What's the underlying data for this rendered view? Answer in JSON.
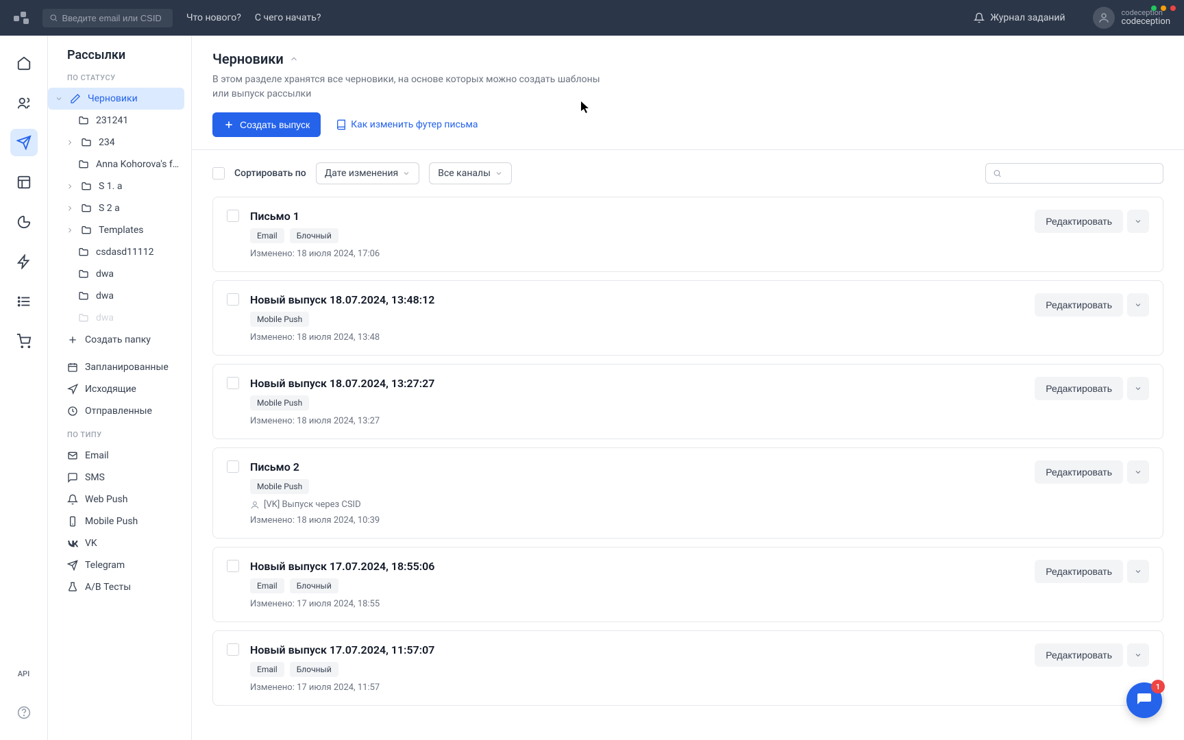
{
  "topbar": {
    "search_placeholder": "Введите email или CSID",
    "links": [
      "Что нового?",
      "С чего начать?"
    ],
    "journal": "Журнал заданий",
    "user_org": "codeception",
    "user_name": "codeception"
  },
  "sidebar": {
    "title": "Рассылки",
    "group_status": "ПО СТАТУСУ",
    "group_type": "ПО ТИПУ",
    "drafts": "Черновики",
    "folders": [
      {
        "label": "231241",
        "has_children": false
      },
      {
        "label": "234",
        "has_children": true
      },
      {
        "label": "Anna Kohorova's f…",
        "has_children": false
      },
      {
        "label": "S 1. a",
        "has_children": true
      },
      {
        "label": "S 2 a",
        "has_children": true
      },
      {
        "label": "Templates",
        "has_children": true
      },
      {
        "label": "csdasd11112",
        "has_children": false
      },
      {
        "label": "dwa",
        "has_children": false
      },
      {
        "label": "dwa",
        "has_children": false
      },
      {
        "label": "dwa",
        "has_children": false,
        "disabled": true
      }
    ],
    "create_folder": "Создать папку",
    "scheduled": "Запланированные",
    "outbox": "Исходящие",
    "sent": "Отправленные",
    "types": [
      "Email",
      "SMS",
      "Web Push",
      "Mobile Push",
      "VK",
      "Telegram",
      "A/B Тесты"
    ]
  },
  "rail": {
    "api": "API"
  },
  "main": {
    "title": "Черновики",
    "desc": "В этом разделе хранятся все черновики, на основе которых можно создать шаблоны или выпуск рассылки",
    "create_btn": "Создать выпуск",
    "footer_link": "Как изменить футер письма",
    "sort_label": "Сортировать по",
    "sort_value": "Дате изменения",
    "channel_value": "Все каналы"
  },
  "drafts": [
    {
      "title": "Письмо 1",
      "tags": [
        "Email",
        "Блочный"
      ],
      "meta_prefix": "Изменено:",
      "meta_date": "18 июля 2024, 17:06",
      "vk_line": null
    },
    {
      "title": "Новый выпуск 18.07.2024, 13:48:12",
      "tags": [
        "Mobile Push"
      ],
      "meta_prefix": "Изменено:",
      "meta_date": "18 июля 2024, 13:48",
      "vk_line": null
    },
    {
      "title": "Новый выпуск 18.07.2024, 13:27:27",
      "tags": [
        "Mobile Push"
      ],
      "meta_prefix": "Изменено:",
      "meta_date": "18 июля 2024, 13:27",
      "vk_line": null
    },
    {
      "title": "Письмо 2",
      "tags": [
        "Mobile Push"
      ],
      "meta_prefix": "Изменено:",
      "meta_date": "18 июля 2024, 10:39",
      "vk_line": "[VK] Выпуск через CSID"
    },
    {
      "title": "Новый выпуск 17.07.2024, 18:55:06",
      "tags": [
        "Email",
        "Блочный"
      ],
      "meta_prefix": "Изменено:",
      "meta_date": "17 июля 2024, 18:55",
      "vk_line": null
    },
    {
      "title": "Новый выпуск 17.07.2024, 11:57:07",
      "tags": [
        "Email",
        "Блочный"
      ],
      "meta_prefix": "Изменено:",
      "meta_date": "17 июля 2024, 11:57",
      "vk_line": null
    }
  ],
  "edit_label": "Редактировать",
  "fab_badge": "1"
}
